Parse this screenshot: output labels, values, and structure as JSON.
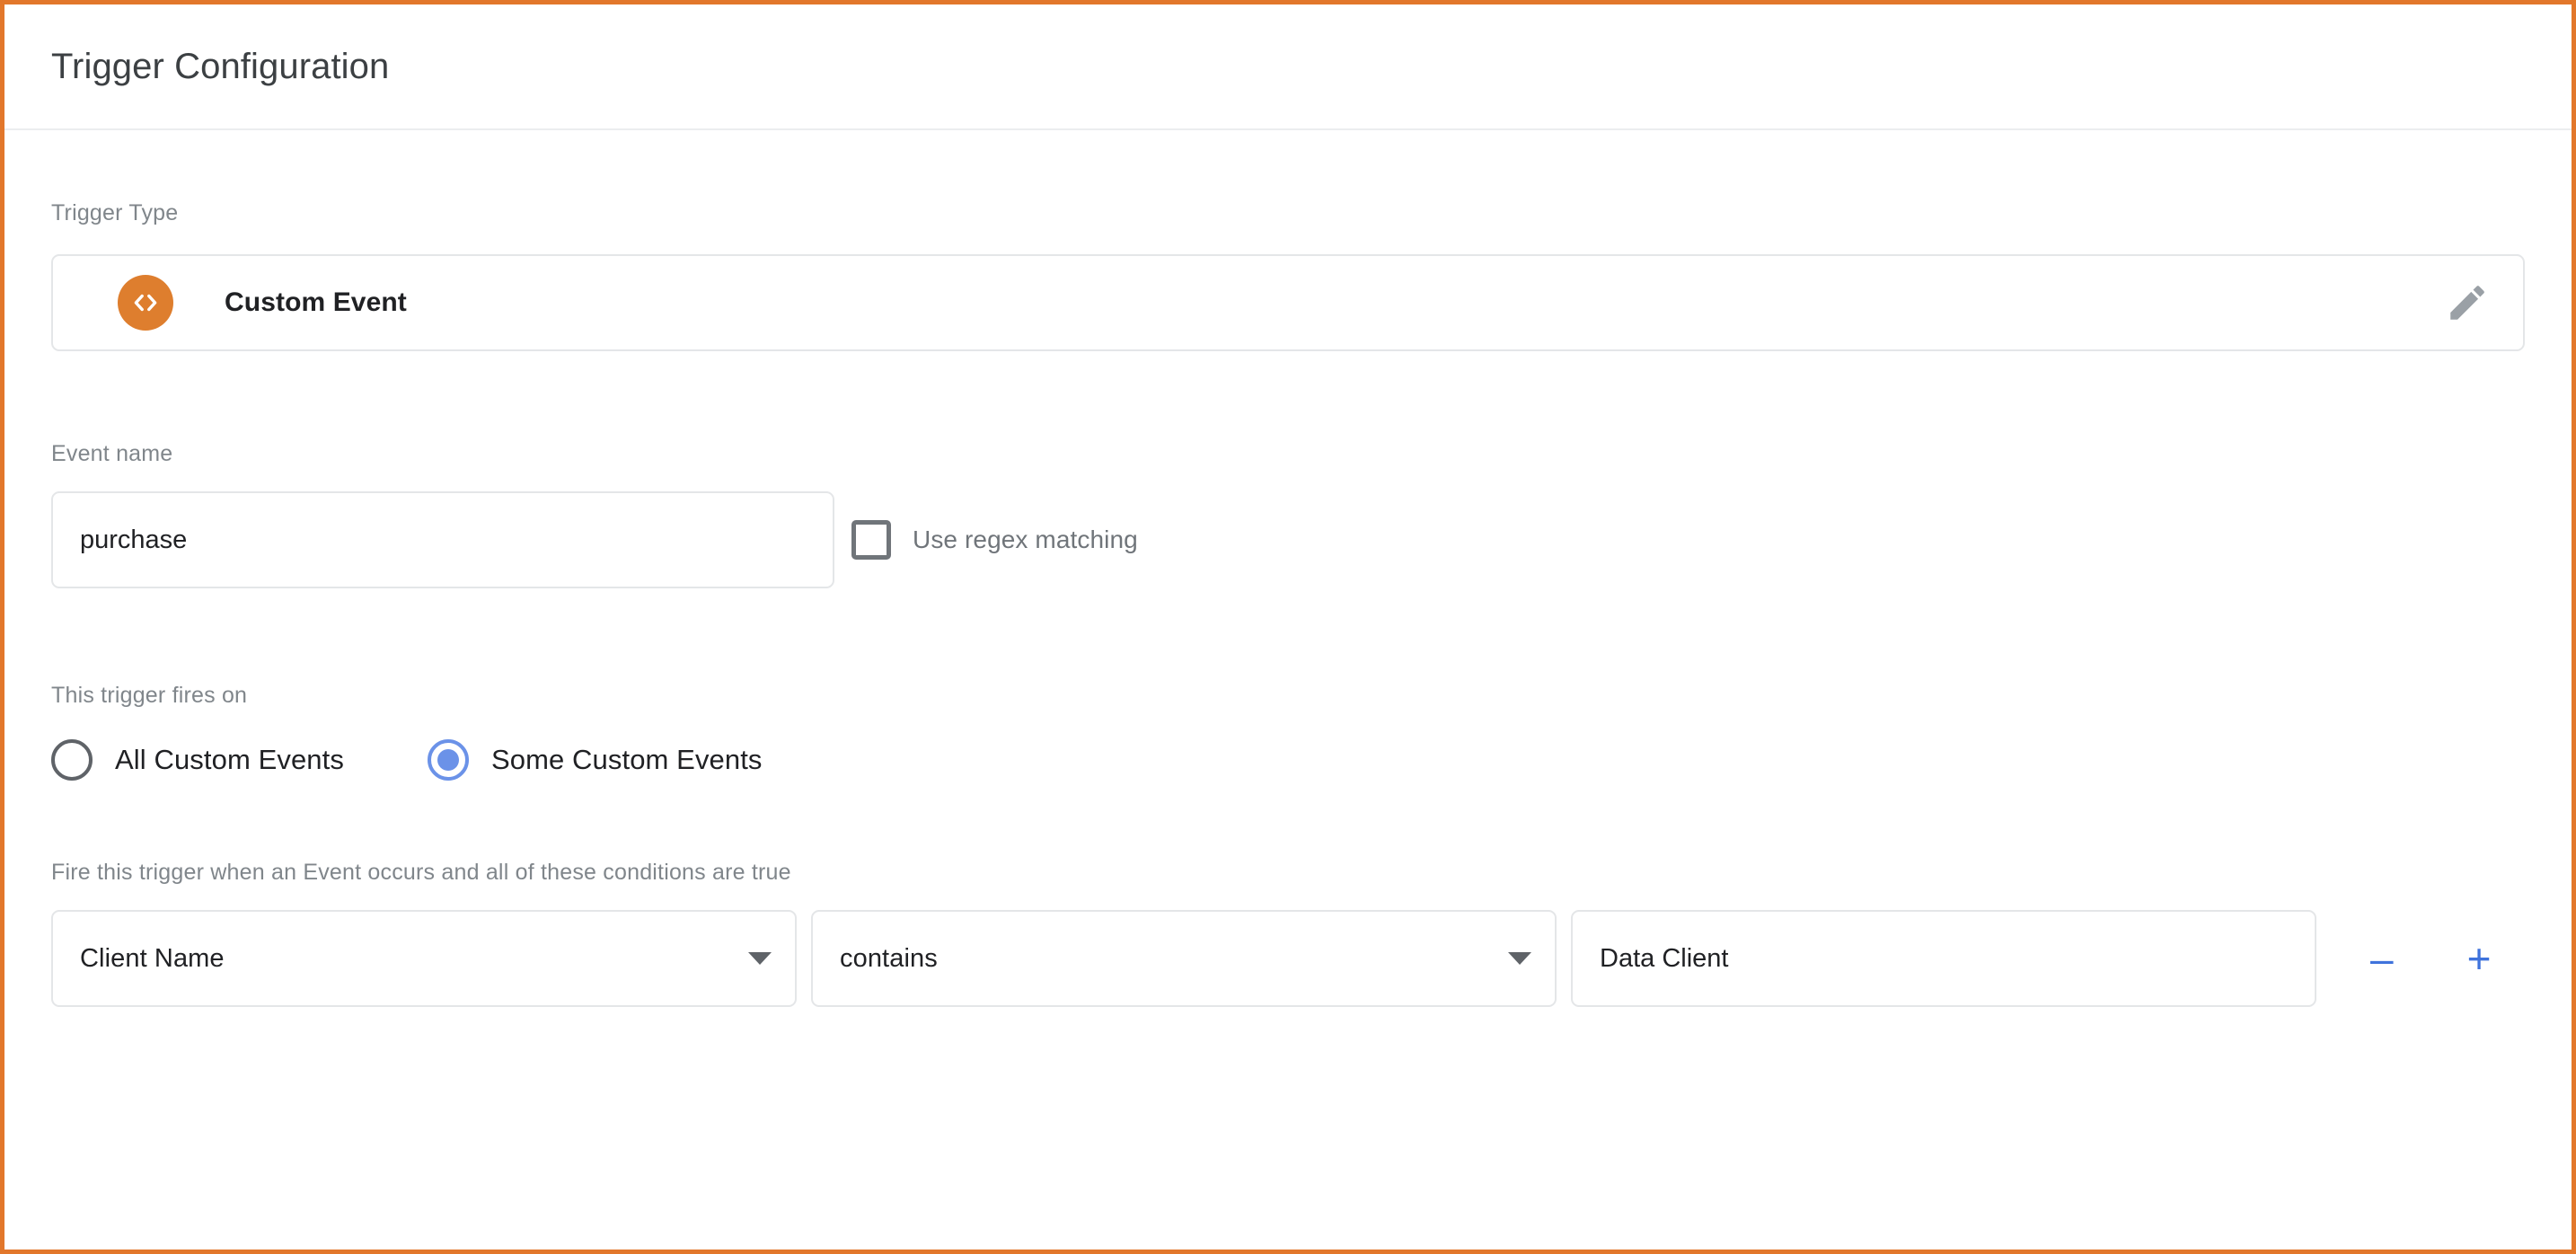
{
  "page": {
    "title": "Trigger Configuration",
    "accent_border_color": "#E2772B"
  },
  "trigger_type": {
    "label": "Trigger Type",
    "name": "Custom Event",
    "icon": "code-brackets-icon",
    "icon_color": "#DE7E2E",
    "edit_icon": "pencil-icon"
  },
  "event_name": {
    "label": "Event name",
    "value": "purchase",
    "placeholder": "",
    "regex_label": "Use regex matching",
    "regex_checked": false
  },
  "fires_on": {
    "label": "This trigger fires on",
    "options": [
      {
        "label": "All Custom Events",
        "selected": false
      },
      {
        "label": "Some Custom Events",
        "selected": true
      }
    ],
    "selected_color": "#6B92E8"
  },
  "conditions": {
    "label": "Fire this trigger when an Event occurs and all of these conditions are true",
    "rows": [
      {
        "variable": "Client Name",
        "operator": "contains",
        "value": "Data Client"
      }
    ],
    "remove_label": "–",
    "add_label": "+",
    "button_color": "#3F73DC"
  }
}
